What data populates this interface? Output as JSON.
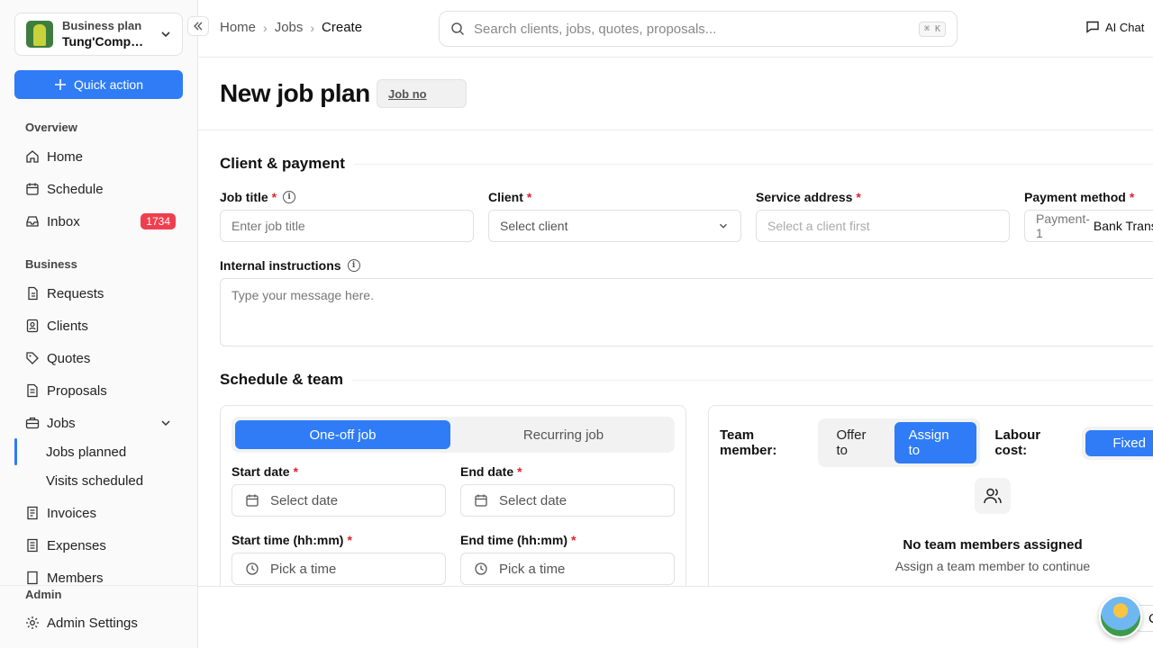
{
  "workspace": {
    "plan": "Business plan",
    "name": "Tung'Company"
  },
  "sidebar": {
    "quick_action": "Quick action",
    "overview_label": "Overview",
    "business_label": "Business",
    "admin_label": "Admin",
    "items": {
      "home": "Home",
      "schedule": "Schedule",
      "inbox": "Inbox",
      "inbox_badge": "1734",
      "requests": "Requests",
      "clients": "Clients",
      "quotes": "Quotes",
      "proposals": "Proposals",
      "jobs": "Jobs",
      "jobs_planned": "Jobs planned",
      "visits_scheduled": "Visits scheduled",
      "invoices": "Invoices",
      "expenses": "Expenses",
      "members": "Members",
      "admin_settings": "Admin Settings"
    }
  },
  "breadcrumb": [
    "Home",
    "Jobs",
    "Create"
  ],
  "search": {
    "placeholder": "Search clients, jobs, quotes, proposals...",
    "shortcut": "⌘ K"
  },
  "ai_chat": "AI Chat",
  "page": {
    "title": "New job plan",
    "job_no": "Job no"
  },
  "client_payment": {
    "title": "Client & payment",
    "job_title_label": "Job title",
    "job_title_placeholder": "Enter job title",
    "client_label": "Client",
    "client_placeholder": "Select client",
    "service_address_label": "Service address",
    "service_address_placeholder": "Select a client first",
    "payment_method_label": "Payment method",
    "payment_method_prefix": "Payment-1",
    "payment_method_value": "Bank Transfer",
    "internal_instructions_label": "Internal instructions",
    "internal_instructions_placeholder": "Type your message here."
  },
  "schedule_team": {
    "title": "Schedule & team",
    "tabs": [
      "One-off job",
      "Recurring job"
    ],
    "start_date_label": "Start date",
    "end_date_label": "End date",
    "date_placeholder": "Select date",
    "start_time_label": "Start time (hh:mm)",
    "end_time_label": "End time (hh:mm)",
    "time_placeholder": "Pick a time",
    "team_member_label": "Team member:",
    "offer_to": "Offer to",
    "assign_to": "Assign to",
    "labour_cost_label": "Labour cost:",
    "labour_fixed": "Fixed",
    "empty_title": "No team members assigned",
    "empty_sub": "Assign a team member to continue"
  },
  "footer": {
    "cancel": "Cancel"
  }
}
